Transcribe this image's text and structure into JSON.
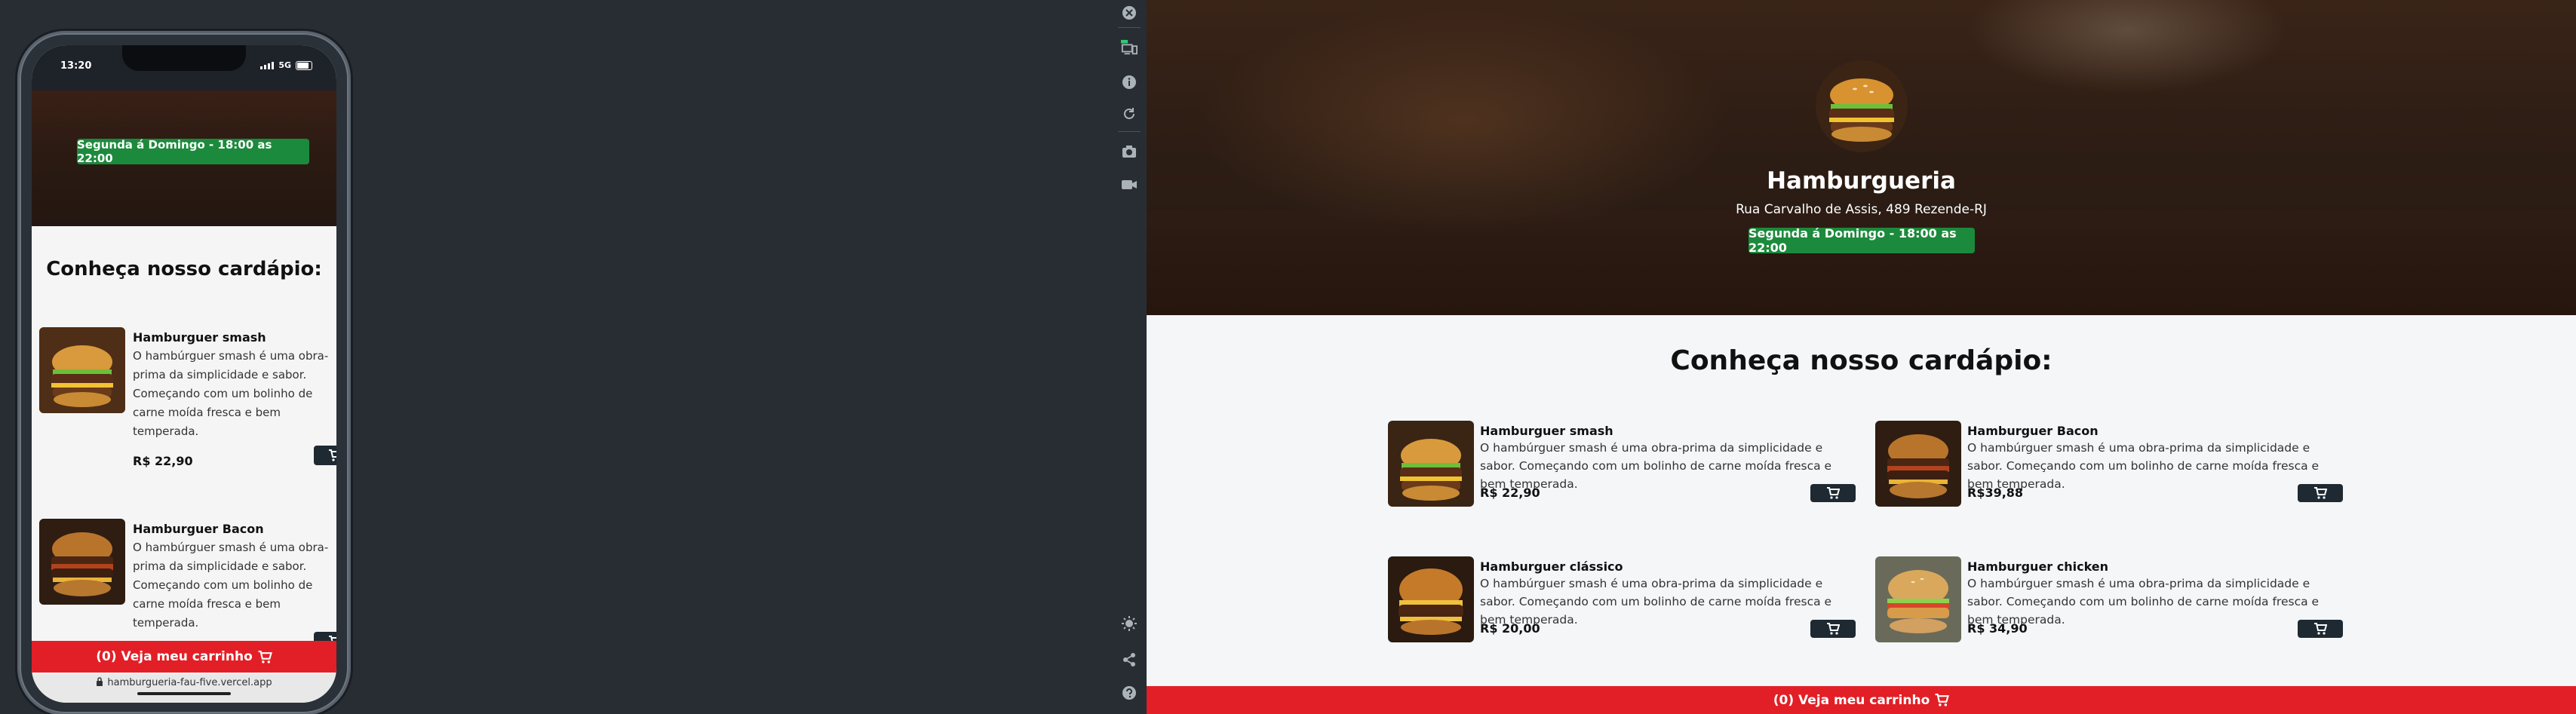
{
  "phone": {
    "status_time": "13:20",
    "status_network": "5G",
    "url": "hamburgueria-fau-five.vercel.app"
  },
  "restaurant": {
    "name": "Hamburgueria",
    "address": "Rua Carvalho de Assis, 489 Rezende-RJ",
    "hours": "Segunda á Domingo - 18:00 as 22:00"
  },
  "menu": {
    "heading": "Conheça nosso cardápio:",
    "items": [
      {
        "name": "Hamburguer smash",
        "desc": "O hambúrguer smash é uma obra-prima da simplicidade e sabor. Começando com um bolinho de carne moída fresca e bem temperada.",
        "price": "R$ 22,90"
      },
      {
        "name": "Hamburguer Bacon",
        "desc": "O hambúrguer smash é uma obra-prima da simplicidade e sabor. Começando com um bolinho de carne moída fresca e bem temperada.",
        "price": "R$39,88"
      },
      {
        "name": "Hamburguer clássico",
        "desc": "O hambúrguer smash é uma obra-prima da simplicidade e sabor. Começando com um bolinho de carne moída fresca e bem temperada.",
        "price": "R$ 20,00"
      },
      {
        "name": "Hamburguer chicken",
        "desc": "O hambúrguer smash é uma obra-prima da simplicidade e sabor. Começando com um bolinho de carne moída fresca e bem temperada.",
        "price": "R$ 34,90"
      }
    ]
  },
  "cart": {
    "label": "(0) Veja meu carrinho"
  },
  "tools": [
    "close-icon",
    "responsive-icon",
    "info-icon",
    "rotate-icon",
    "camera-icon",
    "video-icon",
    "theme-icon",
    "share-icon",
    "help-icon"
  ],
  "colors": {
    "accent_green": "#1c8a3c",
    "cart_red": "#e21f26",
    "button_dark": "#1e2932"
  }
}
